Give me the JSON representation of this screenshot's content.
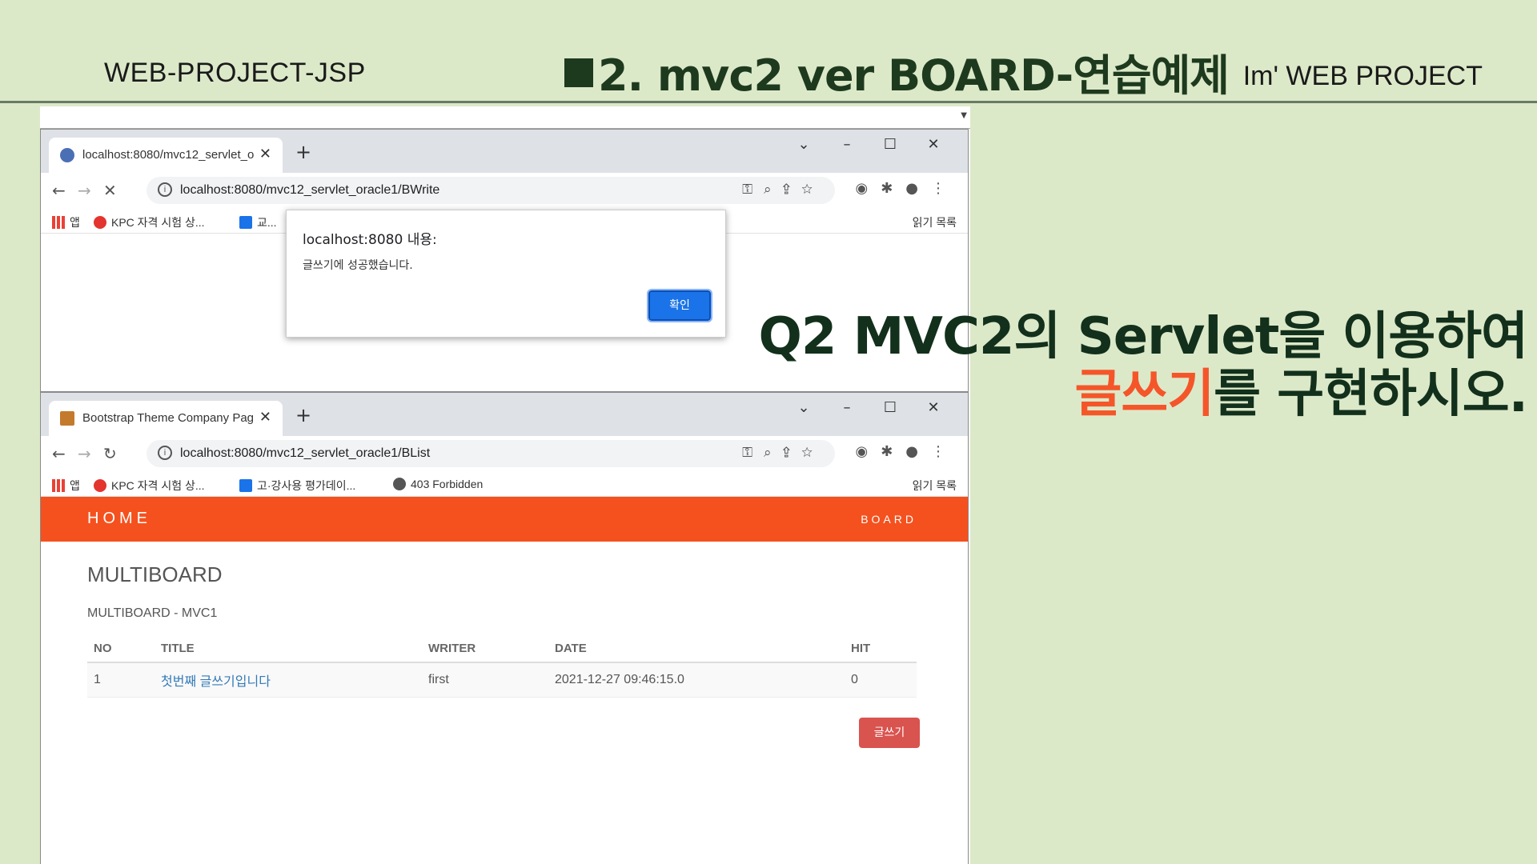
{
  "slide": {
    "left_label": "WEB-PROJECT-JSP",
    "title": "2. mvc2 ver  BOARD-연습예제",
    "right_label": "Im'  WEB PROJECT",
    "question_line1": "Q2  MVC2의 Servlet을 이용하여",
    "question_accent": "글쓰기",
    "question_rest": "를 구현하시오."
  },
  "browser1": {
    "tab_title": "localhost:8080/mvc12_servlet_o",
    "url": "localhost:8080/mvc12_servlet_oracle1/BWrite",
    "bookmarks": [
      "앱",
      "KPC 자격 시험 상...",
      "교..."
    ],
    "reading_list": "읽기 목록",
    "dialog": {
      "title": "localhost:8080 내용:",
      "message": "글쓰기에 성공했습니다.",
      "ok": "확인"
    }
  },
  "browser2": {
    "tab_title": "Bootstrap Theme Company Pag",
    "url": "localhost:8080/mvc12_servlet_oracle1/BList",
    "bookmarks": [
      "앱",
      "KPC 자격 시험 상...",
      "고·강사용 평가데이...",
      "403 Forbidden"
    ],
    "reading_list": "읽기 목록",
    "nav": {
      "home": "HOME",
      "board": "BOARD"
    },
    "page_title": "MULTIBOARD",
    "subtitle": "MULTIBOARD - MVC1",
    "table": {
      "headers": [
        "NO",
        "TITLE",
        "WRITER",
        "DATE",
        "HIT"
      ],
      "rows": [
        [
          "1",
          "첫번째 글쓰기입니다",
          "first",
          "2021-12-27 09:46:15.0",
          "0"
        ]
      ]
    },
    "write_button": "글쓰기"
  },
  "colors": {
    "navbar": "#f4511e",
    "accent": "#f4562a",
    "background": "#dce9c9",
    "write_button": "#d9534f"
  }
}
